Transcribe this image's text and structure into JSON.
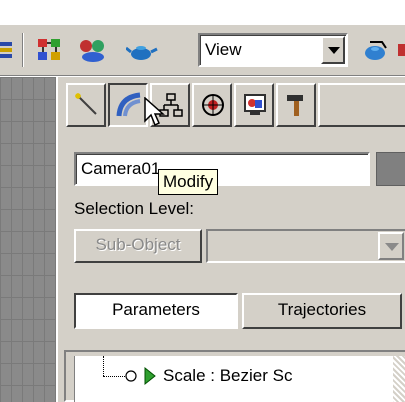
{
  "toolbar": {
    "view_combo_value": "View",
    "icons": [
      "toolbar-left-icon",
      "schematic-icon",
      "material-editor-icon",
      "render-teapot-icon",
      "quick-render-icon"
    ]
  },
  "command_panel": {
    "tabs": [
      {
        "name": "create-tab",
        "icon": "create-wand-icon"
      },
      {
        "name": "modify-tab",
        "icon": "modify-bend-icon",
        "active": true
      },
      {
        "name": "hierarchy-tab",
        "icon": "hierarchy-icon"
      },
      {
        "name": "motion-tab",
        "icon": "motion-icon"
      },
      {
        "name": "display-tab",
        "icon": "display-icon"
      },
      {
        "name": "utilities-tab",
        "icon": "hammer-icon"
      }
    ],
    "tooltip": "Modify",
    "object_name": "Camera01",
    "object_color": "#808080",
    "selection_level_label": "Selection Level:",
    "subobject_button": "Sub-Object",
    "parameters_button": "Parameters",
    "trajectories_button": "Trajectories",
    "track_row": "Scale : Bezier Sc"
  }
}
